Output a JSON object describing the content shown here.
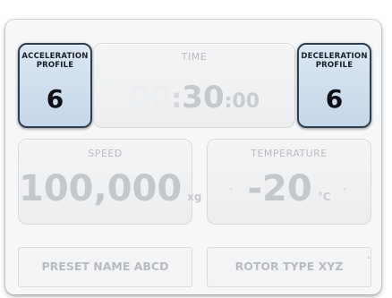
{
  "acceleration": {
    "label_line1": "ACCELERATION",
    "label_line2": "PROFILE",
    "value": "6"
  },
  "deceleration": {
    "label_line1": "DECELERATION",
    "label_line2": "PROFILE",
    "value": "6"
  },
  "time": {
    "label": "TIME",
    "hours": "00",
    "sep": ":",
    "minutes": "30",
    "seconds_sep": ":",
    "seconds": "00"
  },
  "speed": {
    "label": "SPEED",
    "value": "100,000",
    "unit": "xg"
  },
  "temperature": {
    "label": "TEMPERATURE",
    "value": "-20",
    "unit": "°C"
  },
  "preset": {
    "name": "PRESET NAME ABCD",
    "rotor": "ROTOR TYPE XYZ"
  },
  "colors": {
    "profile_border": "#2f3f52",
    "profile_fill": "#c6d7e8",
    "inactive_text": "#c3c8cd"
  }
}
